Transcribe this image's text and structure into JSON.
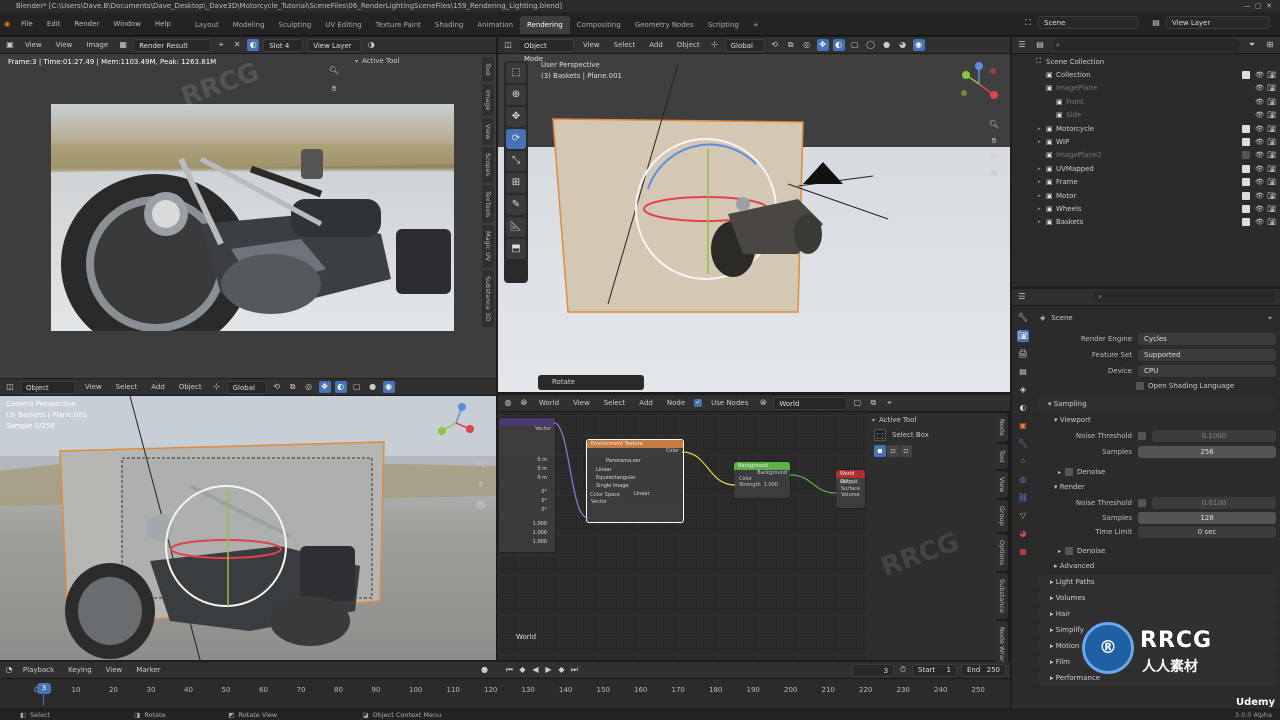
{
  "window": {
    "title": "Blender* [C:\\Users\\Dave.B\\Documents\\Dave_Desktop\\_Dave3D\\Motorcycle_Tutorial\\SceneFiles\\06_RenderLightingSceneFiles\\159_Rendering_Lighting.blend]"
  },
  "menu": [
    "File",
    "Edit",
    "Render",
    "Window",
    "Help"
  ],
  "workspaces": [
    "Layout",
    "Modeling",
    "Sculpting",
    "UV Editing",
    "Texture Paint",
    "Shading",
    "Animation",
    "Rendering",
    "Compositing",
    "Geometry Nodes",
    "Scripting"
  ],
  "active_workspace": "Rendering",
  "scene_field": "Scene",
  "viewlayer_field": "View Layer",
  "image_editor": {
    "view_menu": "View",
    "view2": "View",
    "image_menu": "Image",
    "image_field": "Render Result",
    "slot": "Slot 4",
    "layer": "View Layer",
    "stats": "Frame:3 | Time:01:27.49 | Mem:1103.49M, Peak: 1263.81M",
    "active_tool": "Active Tool",
    "tabs": [
      "Tool",
      "Image",
      "View",
      "Scopes",
      "TexTools",
      "Magic UV",
      "Substance 3D"
    ]
  },
  "viewport_top": {
    "mode": "Object Mode",
    "menus": [
      "View",
      "Select",
      "Add",
      "Object"
    ],
    "orientation": "Global",
    "perspective": "User Perspective",
    "collection_info": "(3) Baskets | Plane.001",
    "operator": "Rotate"
  },
  "viewport_bottom": {
    "mode": "Object Mode",
    "menus": [
      "View",
      "Select",
      "Add",
      "Object"
    ],
    "orientation": "Global",
    "perspective": "Camera Perspective",
    "collection_info": "(3) Baskets | Plane.001",
    "samples": "Sample 0/256"
  },
  "node_editor": {
    "world_label": "World",
    "menus": [
      "View",
      "Select",
      "Add",
      "Node"
    ],
    "use_nodes": "Use Nodes",
    "world_field": "World",
    "active_tool": "Active Tool",
    "select_box": "Select Box",
    "corner_label": "World",
    "tabs": [
      "Node",
      "Tool",
      "View",
      "Group",
      "Options",
      "Substance",
      "Node Wrangler"
    ],
    "left_values": [
      "0 m",
      "0 m",
      "0 m",
      "0°",
      "0°",
      "0°",
      "1.000",
      "1.000",
      "1.000"
    ],
    "nodes": {
      "env": {
        "title": "Environment Texture",
        "out": "Color",
        "image": "Panorama.exr",
        "opts": [
          "Linear",
          "Equirectangular",
          "Single Image"
        ],
        "color_space_label": "Color Space",
        "color_space": "Linear",
        "vector": "Vector"
      },
      "bg": {
        "title": "Background",
        "out": "Background",
        "color": "Color",
        "strength": "Strength",
        "strength_val": "1.000"
      },
      "out": {
        "title": "World Output",
        "all": "All",
        "surface": "Surface",
        "volume": "Volume"
      }
    },
    "mapping_vector": "Vector"
  },
  "outliner": {
    "search_placeholder": "",
    "items": [
      {
        "label": "Scene Collection",
        "indent": 0,
        "dim": false
      },
      {
        "label": "Collection",
        "indent": 1,
        "dim": false
      },
      {
        "label": "ImagePlane",
        "indent": 1,
        "dim": true
      },
      {
        "label": "Front",
        "indent": 2,
        "dim": true
      },
      {
        "label": "Side",
        "indent": 2,
        "dim": true
      },
      {
        "label": "Motorcycle",
        "indent": 1,
        "dim": false
      },
      {
        "label": "WIP",
        "indent": 1,
        "dim": false
      },
      {
        "label": "ImagePlane2",
        "indent": 1,
        "dim": true
      },
      {
        "label": "UVMapped",
        "indent": 1,
        "dim": false
      },
      {
        "label": "Frame",
        "indent": 1,
        "dim": false
      },
      {
        "label": "Motor",
        "indent": 1,
        "dim": false
      },
      {
        "label": "Wheels",
        "indent": 1,
        "dim": false
      },
      {
        "label": "Baskets",
        "indent": 1,
        "dim": false
      }
    ]
  },
  "properties": {
    "scene": "Scene",
    "render_engine_label": "Render Engine",
    "render_engine": "Cycles",
    "feature_set_label": "Feature Set",
    "feature_set": "Supported",
    "device_label": "Device",
    "device": "CPU",
    "osl": "Open Shading Language",
    "sampling": "Sampling",
    "viewport": "Viewport",
    "vp_noise_label": "Noise Threshold",
    "vp_noise": "0.1000",
    "vp_samples_label": "Samples",
    "vp_samples": "256",
    "denoise": "Denoise",
    "render": "Render",
    "r_noise_label": "Noise Threshold",
    "r_noise": "0.0100",
    "r_samples_label": "Samples",
    "r_samples": "128",
    "time_limit_label": "Time Limit",
    "time_limit": "0 sec",
    "denoise2": "Denoise",
    "advanced": "Advanced",
    "sections": [
      "Light Paths",
      "Volumes",
      "Hair",
      "Simplify",
      "Motion Blur",
      "Film",
      "Performance"
    ]
  },
  "timeline": {
    "menus": [
      "Playback",
      "Keying",
      "View",
      "Marker"
    ],
    "current_frame": "3",
    "start_label": "Start",
    "start": "1",
    "end_label": "End",
    "end": "250",
    "ticks": [
      "0",
      "10",
      "20",
      "30",
      "40",
      "50",
      "60",
      "70",
      "80",
      "90",
      "100",
      "110",
      "120",
      "130",
      "140",
      "150",
      "160",
      "170",
      "180",
      "190",
      "200",
      "210",
      "220",
      "230",
      "240",
      "250"
    ],
    "playhead": "3"
  },
  "statusbar": {
    "select": "Select",
    "rotate": "Rotate",
    "rotate_view": "Rotate View",
    "context": "Object Context Menu",
    "version": "3.0.0 Alpha"
  },
  "watermarks": {
    "rrcg": "RRCG",
    "cn": "人人素材",
    "udemy": "Udemy"
  },
  "colors": {
    "accent": "#4772b3",
    "header": "#303030",
    "panel": "#2b2b2b",
    "bg": "#1d1d1d"
  }
}
